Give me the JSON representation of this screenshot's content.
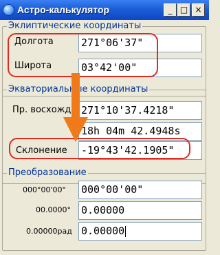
{
  "window": {
    "title": "Астро-калькулятор"
  },
  "titlebar_buttons": {
    "minimize": "_",
    "maximize": "□",
    "close": "×"
  },
  "ecliptic": {
    "title": "Эклиптические координаты",
    "longitude_label": "Долгота",
    "longitude_value": "271°06'37\"",
    "latitude_label": "Широта",
    "latitude_value": "03°42'00\""
  },
  "equatorial": {
    "title": "Экваториальные координаты",
    "ra_label": "Пр. восхожд.",
    "ra_degrees_value": "271°10'37.4218\"",
    "ra_hours_value": "18h 04m 42.4948s",
    "dec_label": "Склонение",
    "dec_value": "-19°43'42.1905\""
  },
  "conversion": {
    "title": "Преобразование",
    "dms_label": "000°00'00\"",
    "dms_value": "000°00'00\"",
    "decimal_label": "00.0000°",
    "decimal_value": "0.00000",
    "radian_label": "0.00000рад",
    "radian_value": "0.00000"
  },
  "colors": {
    "highlight": "#e02a1e",
    "arrow": "#f07a1a",
    "titlebar": "#1c5ed6",
    "legend": "#003399"
  }
}
